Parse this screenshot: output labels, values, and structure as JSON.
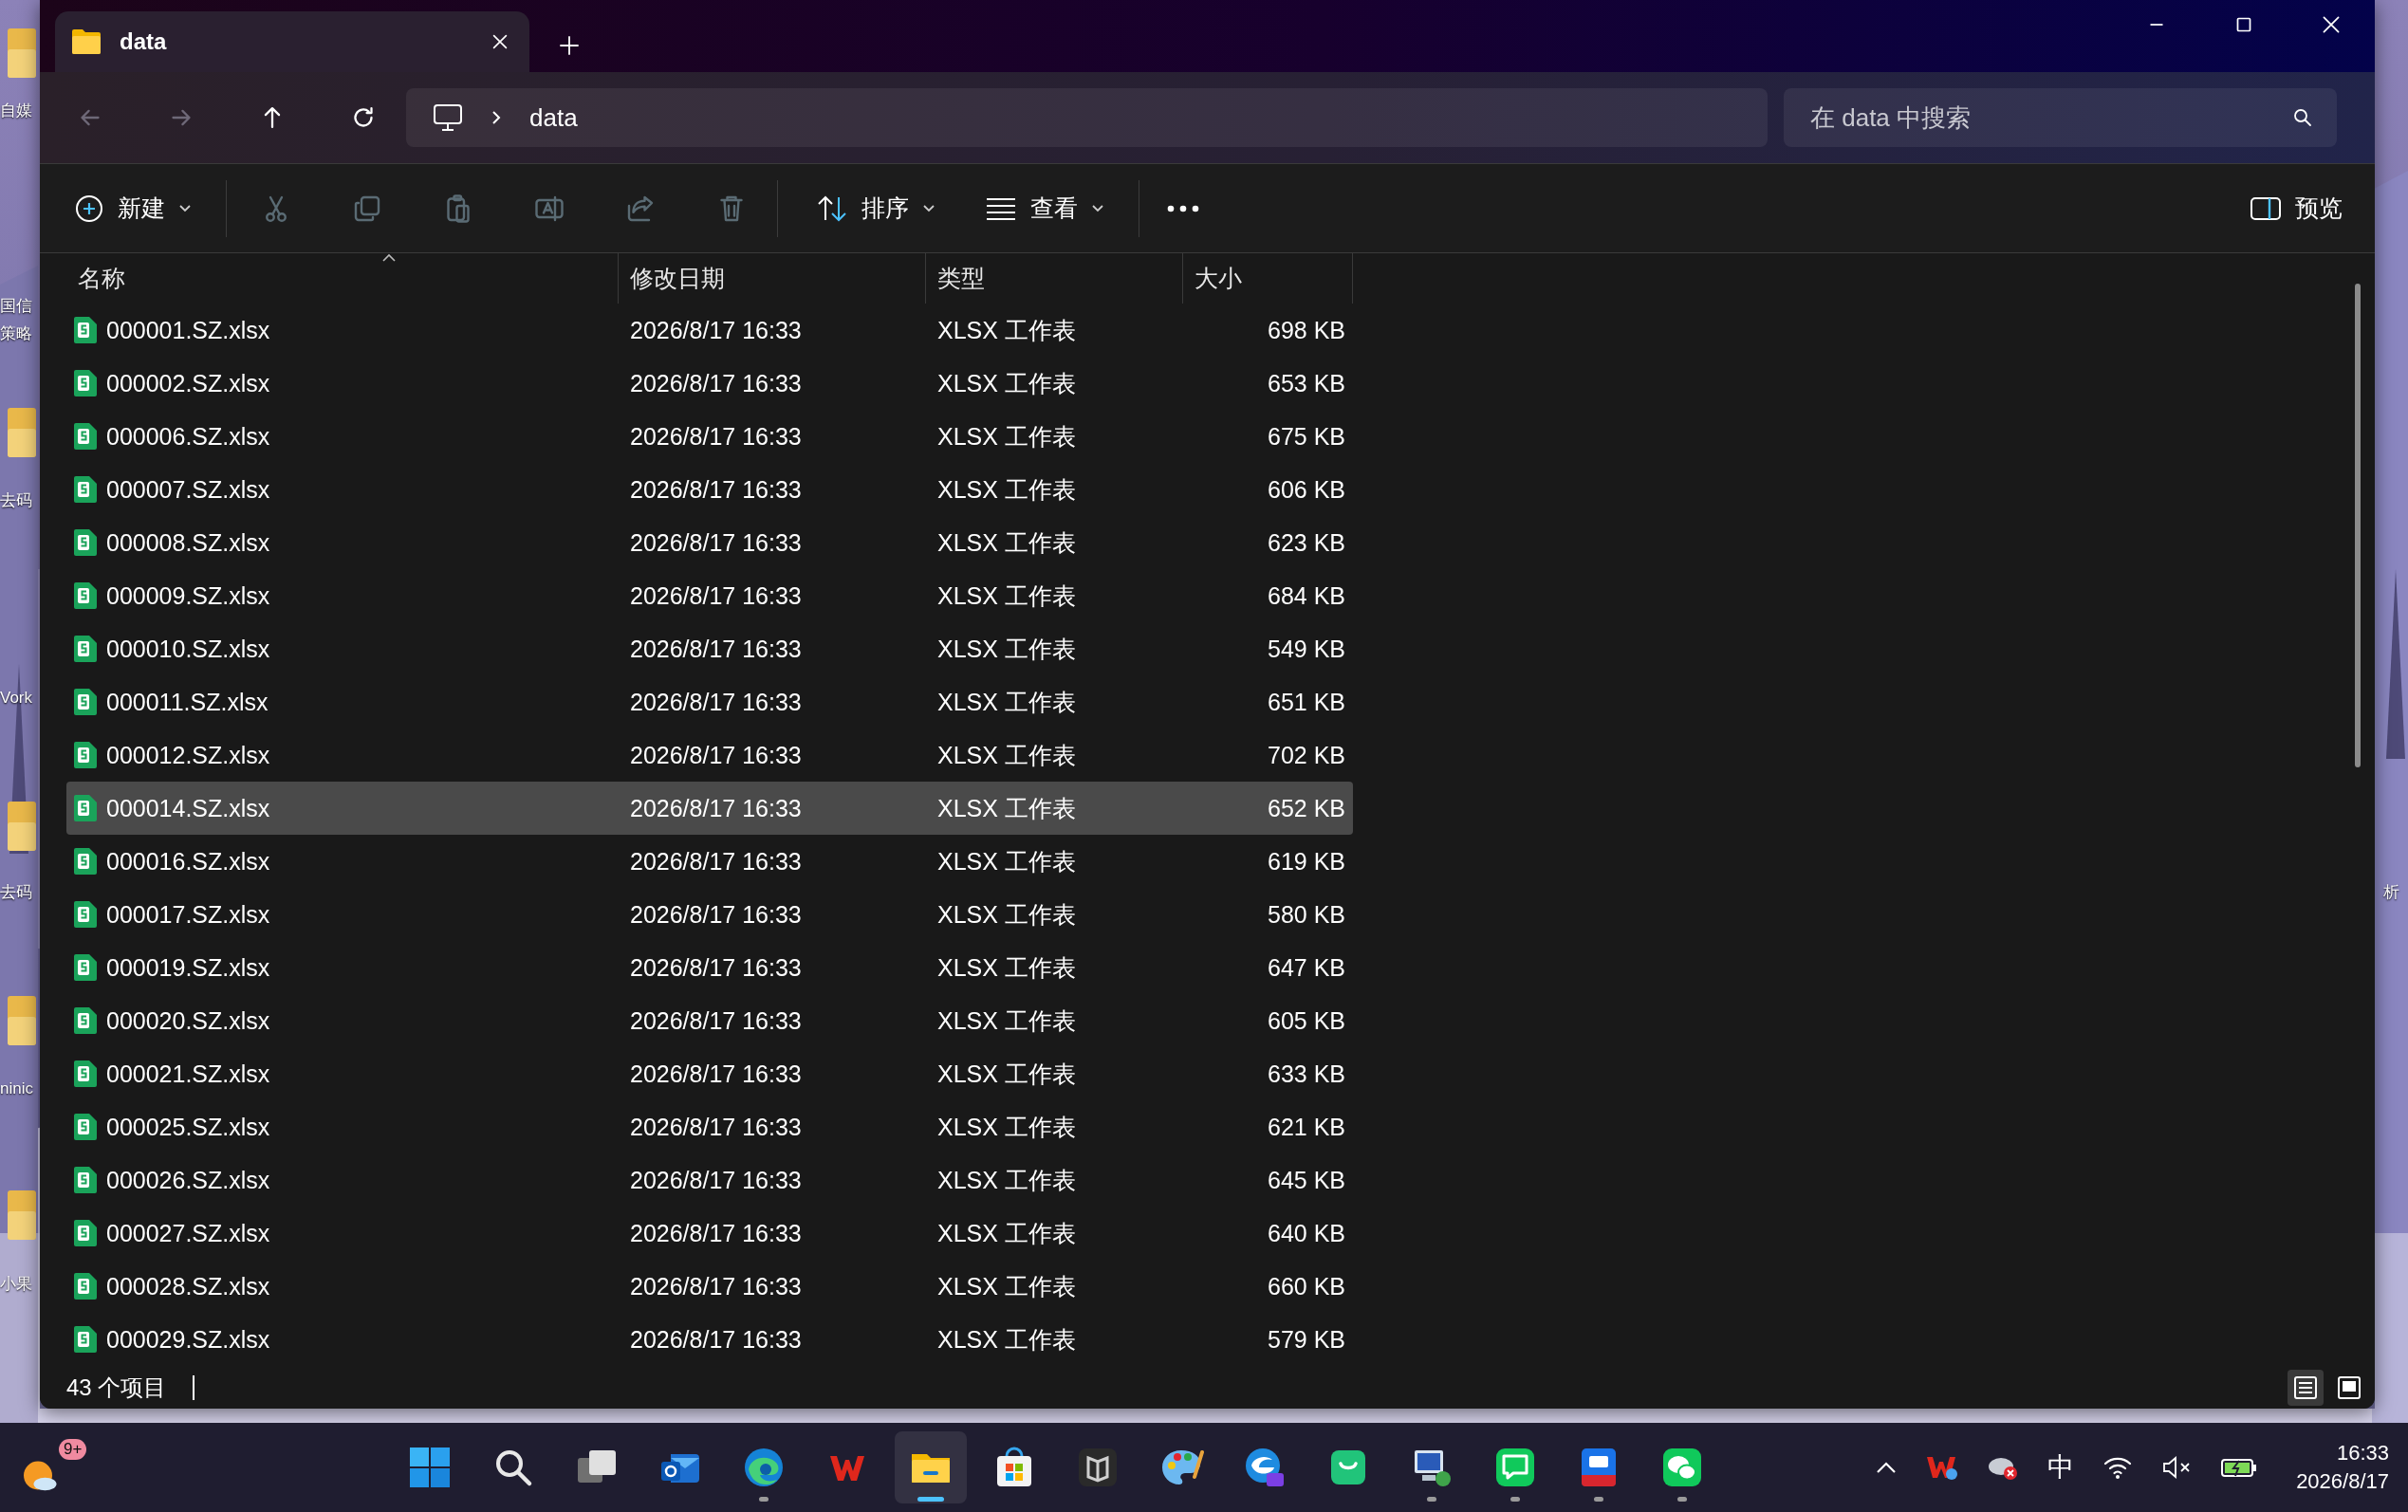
{
  "desktop": {
    "left_labels": [
      "自媒",
      "国信",
      "策略",
      "去码",
      "Vork",
      "去码",
      "ninic",
      "小果"
    ],
    "right_labels": [
      "析"
    ]
  },
  "window": {
    "tabs": [
      {
        "label": "data",
        "selected": true
      }
    ]
  },
  "address_bar": {
    "nav": [
      {
        "kind": "back",
        "disabled": true
      },
      {
        "kind": "forward",
        "disabled": true
      },
      {
        "kind": "up",
        "disabled": false
      },
      {
        "kind": "refresh",
        "disabled": false
      }
    ],
    "path": [
      "data"
    ],
    "search_placeholder": "在 data 中搜索"
  },
  "toolbar": {
    "new": "新建",
    "actions": [
      {
        "kind": "cut",
        "disabled": true
      },
      {
        "kind": "copy",
        "disabled": true
      },
      {
        "kind": "paste",
        "disabled": true
      },
      {
        "kind": "rename",
        "disabled": true
      },
      {
        "kind": "share",
        "disabled": true
      },
      {
        "kind": "delete",
        "disabled": true
      }
    ],
    "sort": "排序",
    "view": "查看",
    "preview": "预览"
  },
  "table": {
    "columns": [
      "名称",
      "修改日期",
      "类型",
      "大小"
    ],
    "rows": [
      {
        "name": "000001.SZ.xlsx",
        "date": "2026/8/17 16:33",
        "type": "XLSX 工作表",
        "size": "698 KB",
        "selected": false
      },
      {
        "name": "000002.SZ.xlsx",
        "date": "2026/8/17 16:33",
        "type": "XLSX 工作表",
        "size": "653 KB",
        "selected": false
      },
      {
        "name": "000006.SZ.xlsx",
        "date": "2026/8/17 16:33",
        "type": "XLSX 工作表",
        "size": "675 KB",
        "selected": false
      },
      {
        "name": "000007.SZ.xlsx",
        "date": "2026/8/17 16:33",
        "type": "XLSX 工作表",
        "size": "606 KB",
        "selected": false
      },
      {
        "name": "000008.SZ.xlsx",
        "date": "2026/8/17 16:33",
        "type": "XLSX 工作表",
        "size": "623 KB",
        "selected": false
      },
      {
        "name": "000009.SZ.xlsx",
        "date": "2026/8/17 16:33",
        "type": "XLSX 工作表",
        "size": "684 KB",
        "selected": false
      },
      {
        "name": "000010.SZ.xlsx",
        "date": "2026/8/17 16:33",
        "type": "XLSX 工作表",
        "size": "549 KB",
        "selected": false
      },
      {
        "name": "000011.SZ.xlsx",
        "date": "2026/8/17 16:33",
        "type": "XLSX 工作表",
        "size": "651 KB",
        "selected": false
      },
      {
        "name": "000012.SZ.xlsx",
        "date": "2026/8/17 16:33",
        "type": "XLSX 工作表",
        "size": "702 KB",
        "selected": false
      },
      {
        "name": "000014.SZ.xlsx",
        "date": "2026/8/17 16:33",
        "type": "XLSX 工作表",
        "size": "652 KB",
        "selected": true
      },
      {
        "name": "000016.SZ.xlsx",
        "date": "2026/8/17 16:33",
        "type": "XLSX 工作表",
        "size": "619 KB",
        "selected": false
      },
      {
        "name": "000017.SZ.xlsx",
        "date": "2026/8/17 16:33",
        "type": "XLSX 工作表",
        "size": "580 KB",
        "selected": false
      },
      {
        "name": "000019.SZ.xlsx",
        "date": "2026/8/17 16:33",
        "type": "XLSX 工作表",
        "size": "647 KB",
        "selected": false
      },
      {
        "name": "000020.SZ.xlsx",
        "date": "2026/8/17 16:33",
        "type": "XLSX 工作表",
        "size": "605 KB",
        "selected": false
      },
      {
        "name": "000021.SZ.xlsx",
        "date": "2026/8/17 16:33",
        "type": "XLSX 工作表",
        "size": "633 KB",
        "selected": false
      },
      {
        "name": "000025.SZ.xlsx",
        "date": "2026/8/17 16:33",
        "type": "XLSX 工作表",
        "size": "621 KB",
        "selected": false
      },
      {
        "name": "000026.SZ.xlsx",
        "date": "2026/8/17 16:33",
        "type": "XLSX 工作表",
        "size": "645 KB",
        "selected": false
      },
      {
        "name": "000027.SZ.xlsx",
        "date": "2026/8/17 16:33",
        "type": "XLSX 工作表",
        "size": "640 KB",
        "selected": false
      },
      {
        "name": "000028.SZ.xlsx",
        "date": "2026/8/17 16:33",
        "type": "XLSX 工作表",
        "size": "660 KB",
        "selected": false
      },
      {
        "name": "000029.SZ.xlsx",
        "date": "2026/8/17 16:33",
        "type": "XLSX 工作表",
        "size": "579 KB",
        "selected": false
      }
    ]
  },
  "status_bar": {
    "count": "43 个项目",
    "view_modes": [
      {
        "kind": "details",
        "selected": true
      },
      {
        "kind": "tiles",
        "selected": false
      }
    ]
  },
  "taskbar": {
    "weather_badge": "9+",
    "apps": [
      {
        "kind": "start",
        "running": false,
        "active": false
      },
      {
        "kind": "search",
        "running": false,
        "active": false
      },
      {
        "kind": "taskview",
        "running": false,
        "active": false
      },
      {
        "kind": "mail",
        "running": false,
        "active": false
      },
      {
        "kind": "browser",
        "running": true,
        "active": false
      },
      {
        "kind": "office",
        "running": false,
        "active": false
      },
      {
        "kind": "folder",
        "running": true,
        "active": true
      },
      {
        "kind": "store",
        "running": false,
        "active": false
      },
      {
        "kind": "cube",
        "running": false,
        "active": false
      },
      {
        "kind": "paint",
        "running": false,
        "active": false
      },
      {
        "kind": "browser-ai",
        "running": false,
        "active": false
      },
      {
        "kind": "bag",
        "running": false,
        "active": false
      },
      {
        "kind": "remote",
        "running": true,
        "active": false
      },
      {
        "kind": "chat",
        "running": true,
        "active": false
      },
      {
        "kind": "trading",
        "running": true,
        "active": false
      },
      {
        "kind": "messenger",
        "running": true,
        "active": false
      }
    ],
    "tray": {
      "ime": "中"
    },
    "clock": {
      "time": "16:33",
      "date": "2026/8/17"
    }
  }
}
